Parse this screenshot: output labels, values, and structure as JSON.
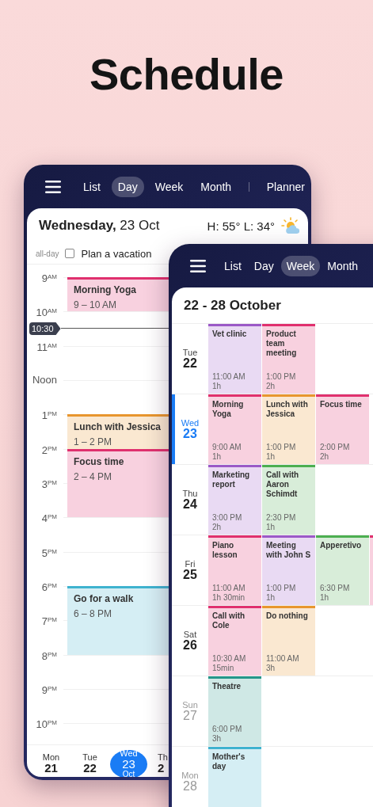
{
  "title": "Schedule",
  "day_view": {
    "tabs": [
      {
        "label": "List",
        "selected": false,
        "divider_before": false
      },
      {
        "label": "Day",
        "selected": true,
        "divider_before": false
      },
      {
        "label": "Week",
        "selected": false,
        "divider_before": false
      },
      {
        "label": "Month",
        "selected": false,
        "divider_before": false
      },
      {
        "label": "Planner",
        "selected": false,
        "divider_before": true
      }
    ],
    "date": "**Wednesday,** 23 Oct",
    "weather": "H: 55° L: 34°",
    "all_day": {
      "label": "all-day",
      "text": "Plan a vacation",
      "checked": false
    },
    "hours": [
      {
        "hour": "9",
        "suffix": "AM",
        "event": {
          "title": "Morning Yoga",
          "time": "9 – 10 AM",
          "color": "#e0306e"
        }
      },
      {
        "hour": "10",
        "suffix": "AM",
        "now": "10:30"
      },
      {
        "hour": "11",
        "suffix": "AM"
      },
      {
        "hour": "Noon"
      },
      {
        "hour": "1",
        "suffix": "PM",
        "event": {
          "title": "Lunch with Jessica",
          "time": "1 – 2 PM",
          "color": "#e8962e"
        }
      },
      {
        "hour": "2",
        "suffix": "PM",
        "event": {
          "title": "Focus time",
          "time": "2 – 4 PM",
          "color": "#e0306e"
        }
      },
      {
        "hour": "3",
        "suffix": "PM"
      },
      {
        "hour": "4",
        "suffix": "PM"
      },
      {
        "hour": "5",
        "suffix": "PM"
      },
      {
        "hour": "6",
        "suffix": "PM",
        "event": {
          "title": "Go for a walk",
          "time": "6 – 8 PM",
          "color": "#3fb3cf"
        }
      },
      {
        "hour": "7",
        "suffix": "PM"
      },
      {
        "hour": "8",
        "suffix": "PM"
      },
      {
        "hour": "9",
        "suffix": "PM"
      },
      {
        "hour": "10",
        "suffix": "PM"
      }
    ],
    "days": [
      {
        "weekday": "Mon",
        "date": "21",
        "selected": false
      },
      {
        "weekday": "Tue",
        "date": "22",
        "selected": false
      },
      {
        "weekday": "Wed",
        "date": "23",
        "month": "Oct",
        "selected": true
      },
      {
        "weekday": "Th",
        "date": "2",
        "selected": false
      }
    ]
  },
  "week_view": {
    "tabs": [
      {
        "label": "List",
        "selected": false
      },
      {
        "label": "Day",
        "selected": false
      },
      {
        "label": "Week",
        "selected": true
      },
      {
        "label": "Month",
        "selected": false
      }
    ],
    "range": "22 - 28 October",
    "days": [
      {
        "weekday": "Tue",
        "date": "22",
        "selected": false,
        "muted": false,
        "events": [
          {
            "title": "Vet clinic",
            "time": "11:00 AM",
            "duration": "1h",
            "color": "#9b59c7"
          },
          {
            "title": "Product team meeting",
            "time": "1:00 PM",
            "duration": "2h",
            "color": "#e0306e"
          }
        ]
      },
      {
        "weekday": "Wed",
        "date": "23",
        "selected": true,
        "muted": false,
        "events": [
          {
            "title": "Morning Yoga",
            "time": "9:00 AM",
            "duration": "1h",
            "color": "#e0306e"
          },
          {
            "title": "Lunch with Jessica",
            "time": "1:00 PM",
            "duration": "1h",
            "color": "#e8962e"
          },
          {
            "title": "Focus time",
            "time": "2:00 PM",
            "duration": "2h",
            "color": "#e0306e"
          }
        ]
      },
      {
        "weekday": "Thu",
        "date": "24",
        "selected": false,
        "muted": false,
        "events": [
          {
            "title": "Marketing report",
            "time": "3:00 PM",
            "duration": "2h",
            "color": "#9b59c7"
          },
          {
            "title": "Call with Aaron Schimdt",
            "time": "2:30 PM",
            "duration": "1h",
            "color": "#4caf50"
          }
        ]
      },
      {
        "weekday": "Fri",
        "date": "25",
        "selected": false,
        "muted": false,
        "events": [
          {
            "title": "Piano lesson",
            "time": "11:00 AM",
            "duration": "1h 30min",
            "color": "#e0306e"
          },
          {
            "title": "Meeting with John S",
            "time": "1:00 PM",
            "duration": "1h",
            "color": "#9b59c7"
          },
          {
            "title": "Apperetivo",
            "time": "6:30 PM",
            "duration": "1h",
            "color": "#4caf50"
          },
          {
            "color": "#e0306e"
          }
        ]
      },
      {
        "weekday": "Sat",
        "date": "26",
        "selected": false,
        "muted": false,
        "events": [
          {
            "title": "Call with Cole",
            "time": "10:30 AM",
            "duration": "15min",
            "color": "#e0306e"
          },
          {
            "title": "Do nothing",
            "time": "11:00 AM",
            "duration": "3h",
            "color": "#e8962e"
          }
        ]
      },
      {
        "weekday": "Sun",
        "date": "27",
        "selected": false,
        "muted": true,
        "events": [
          {
            "title": "Theatre",
            "time": "6:00 PM",
            "duration": "3h",
            "color": "#26968a"
          }
        ]
      },
      {
        "weekday": "Mon",
        "date": "28",
        "selected": false,
        "muted": true,
        "events": [
          {
            "title": "Mother's day",
            "color": "#3fb3cf"
          }
        ]
      }
    ]
  }
}
